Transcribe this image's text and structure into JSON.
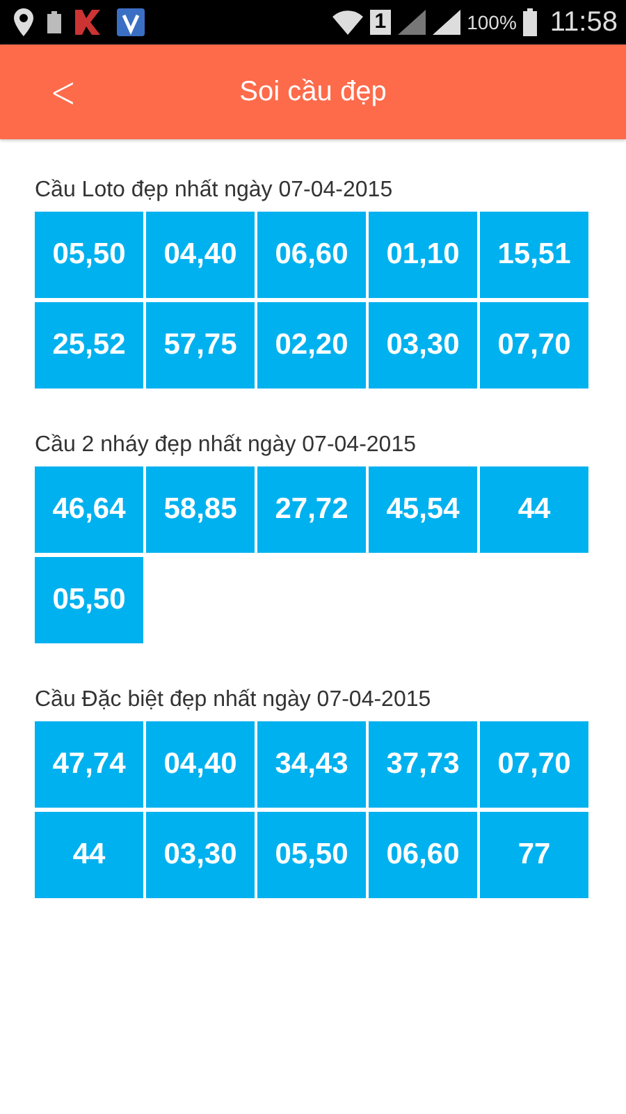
{
  "status_bar": {
    "sim": "1",
    "battery": "100%",
    "time": "11:58"
  },
  "header": {
    "back": "<",
    "title": "Soi cầu đẹp"
  },
  "sections": [
    {
      "title": "Cầu Loto đẹp nhất ngày 07-04-2015",
      "cells": [
        "05,50",
        "04,40",
        "06,60",
        "01,10",
        "15,51",
        "25,52",
        "57,75",
        "02,20",
        "03,30",
        "07,70"
      ]
    },
    {
      "title": "Cầu 2 nháy đẹp nhất ngày 07-04-2015",
      "cells": [
        "46,64",
        "58,85",
        "27,72",
        "45,54",
        "44",
        "05,50"
      ]
    },
    {
      "title": "Cầu Đặc biệt đẹp nhất ngày 07-04-2015",
      "cells": [
        "47,74",
        "04,40",
        "34,43",
        "37,73",
        "07,70",
        "44",
        "03,30",
        "05,50",
        "06,60",
        "77"
      ]
    }
  ]
}
